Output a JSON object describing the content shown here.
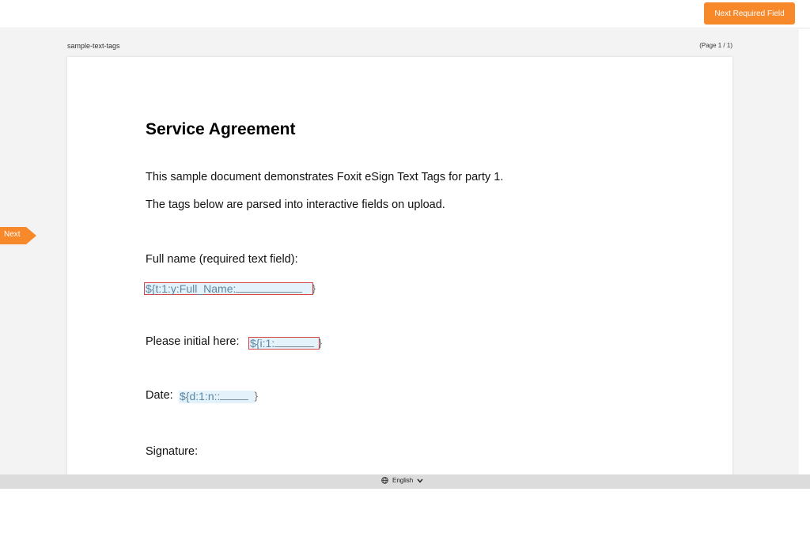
{
  "toolbar": {
    "next_required_label": "Next Required Field"
  },
  "viewer": {
    "document_name": "sample-text-tags",
    "page_indicator": "(Page 1 / 1)",
    "next_marker_label": "Next"
  },
  "document": {
    "title": "Service Agreement",
    "paragraph_1": "This sample document demonstrates Foxit eSign Text Tags for party 1.",
    "paragraph_2": "The tags below are parsed into interactive fields on upload.",
    "full_name_label": "Full name (required text field):",
    "full_name_tag": "${t:1:y:Full_Name:",
    "initial_label": "Please initial here:",
    "initial_tag": "${i:1:",
    "date_label": "Date:",
    "date_tag": "${d:1:n::",
    "signature_label": "Signature:"
  },
  "footer": {
    "language": "English"
  },
  "colors": {
    "accent": "#f7892b",
    "field_fill": "#e4f2fb",
    "required_border": "#d64545"
  },
  "icons": {
    "language": "globe-icon",
    "dropdown": "chevron-down-icon",
    "next_marker": "arrow-right-icon"
  }
}
